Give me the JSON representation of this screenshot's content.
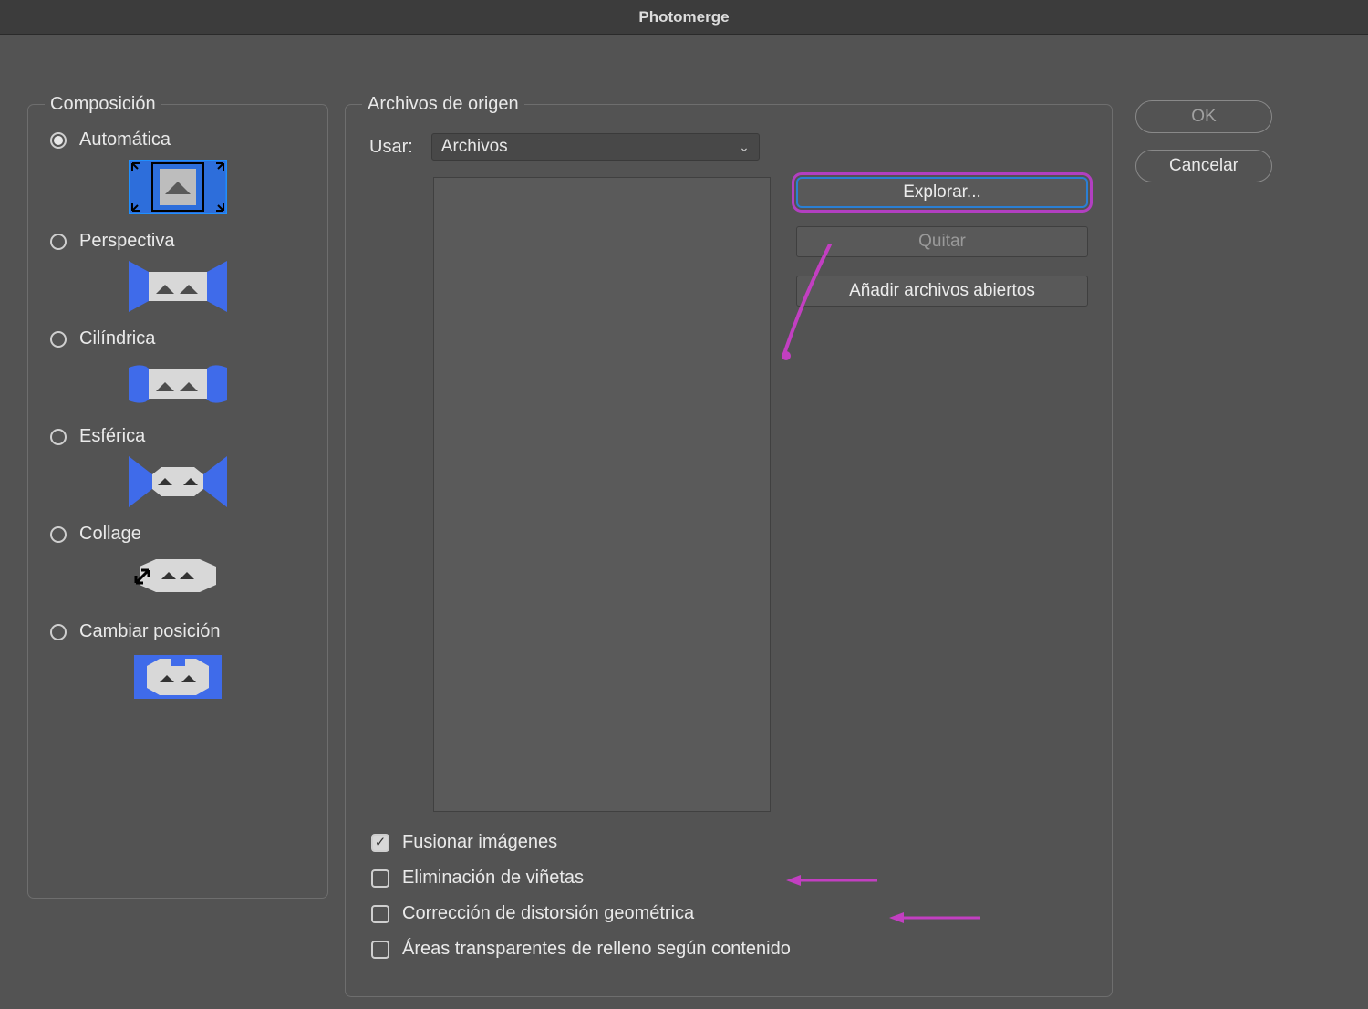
{
  "window_title": "Photomerge",
  "buttons": {
    "ok": "OK",
    "cancel": "Cancelar"
  },
  "composition_panel": {
    "legend": "Composición",
    "selected_index": 0,
    "options": [
      {
        "label": "Automática"
      },
      {
        "label": "Perspectiva"
      },
      {
        "label": "Cilíndrica"
      },
      {
        "label": "Esférica"
      },
      {
        "label": "Collage"
      },
      {
        "label": "Cambiar posición"
      }
    ]
  },
  "source_panel": {
    "legend": "Archivos de origen",
    "use_label": "Usar:",
    "use_value": "Archivos",
    "buttons": {
      "browse": "Explorar...",
      "remove": "Quitar",
      "add_open": "Añadir archivos abiertos"
    },
    "checkboxes": [
      {
        "label": "Fusionar imágenes",
        "checked": true
      },
      {
        "label": "Eliminación de viñetas",
        "checked": false
      },
      {
        "label": "Corrección de distorsión geométrica",
        "checked": false
      },
      {
        "label": "Áreas transparentes de relleno según contenido",
        "checked": false
      }
    ]
  },
  "annotation_color": "#c23fc1"
}
